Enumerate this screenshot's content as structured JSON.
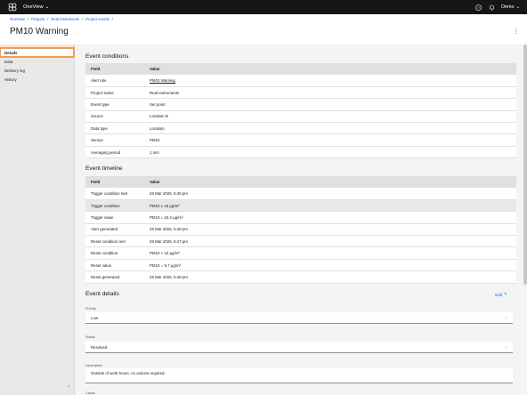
{
  "app": {
    "name": "OneView",
    "user": "Demo"
  },
  "breadcrumb": [
    "OneView",
    "Projects",
    "Real Instruments",
    "Project events"
  ],
  "page_title": "PM10 Warning",
  "sidebar": {
    "items": [
      "Details",
      "Data",
      "Delivery log",
      "History"
    ]
  },
  "conditions": {
    "title": "Event conditions",
    "headers": [
      "Field",
      "Value"
    ],
    "rows": [
      [
        "Alert rule",
        "PM10 Warning"
      ],
      [
        "Project name",
        "Real Instruments"
      ],
      [
        "Event type",
        "Set point"
      ],
      [
        "Source",
        "Location B"
      ],
      [
        "Data type",
        "Location"
      ],
      [
        "Sensor",
        "PM10"
      ],
      [
        "Averaging period",
        "1 min"
      ]
    ]
  },
  "timeline": {
    "title": "Event timeline",
    "headers": [
      "Field",
      "Value"
    ],
    "rows": [
      [
        "Trigger condition met",
        "26 Mar 2026, 5:46 pm"
      ],
      [
        "Trigger condition",
        "PM10 ≥ 15 µg/m³"
      ],
      [
        "Trigger value",
        "PM10 = 15.2 µg/m³"
      ],
      [
        "Alert generated",
        "26 Mar 2026, 5:48 pm"
      ],
      [
        "Reset condition met",
        "26 Mar 2026, 6:47 pm"
      ],
      [
        "Reset condition",
        "PM10 < 10 µg/m³"
      ],
      [
        "Reset value",
        "PM10 = 9.7 µg/m³"
      ],
      [
        "Reset generated",
        "26 Mar 2026, 6:49 pm"
      ]
    ]
  },
  "details": {
    "title": "Event details",
    "edit_label": "Edit",
    "priority_label": "Priority",
    "priority_value": "Low",
    "status_label": "Status",
    "status_value": "Resolved",
    "description_label": "Description",
    "description_value": "Outside of work hours, no actions required.",
    "cause_label": "Cause"
  }
}
